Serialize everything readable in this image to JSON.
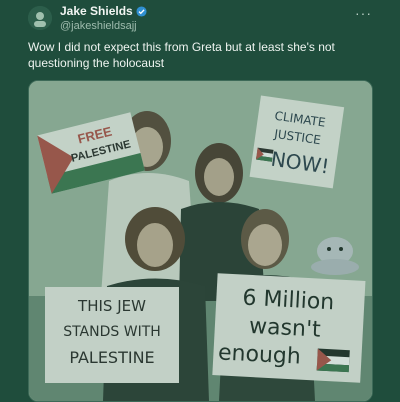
{
  "author": {
    "name": "Jake Shields",
    "handle": "@jakeshieldsajj",
    "verified": true
  },
  "menu_icon": "more-dots-icon",
  "tweet_text": "Wow I did not expect this from Greta but at least she's not questioning the holocaust",
  "media": {
    "signs": {
      "free_line1": "FREE",
      "free_line2": "PALESTINE",
      "climate_line1": "CLIMATE",
      "climate_line2": "JUSTICE",
      "climate_line3": "NOW!",
      "jew_line1": "THIS JEW",
      "jew_line2": "STANDS WITH",
      "jew_line3": "PALESTINE",
      "million_line1": "6 Million",
      "million_line2": "wasn't",
      "million_line3": "enough"
    }
  },
  "colors": {
    "background": "#1f4d3c",
    "tint": "#7fa58c",
    "flag_red": "#b5524b",
    "flag_green": "#3f7a52"
  }
}
